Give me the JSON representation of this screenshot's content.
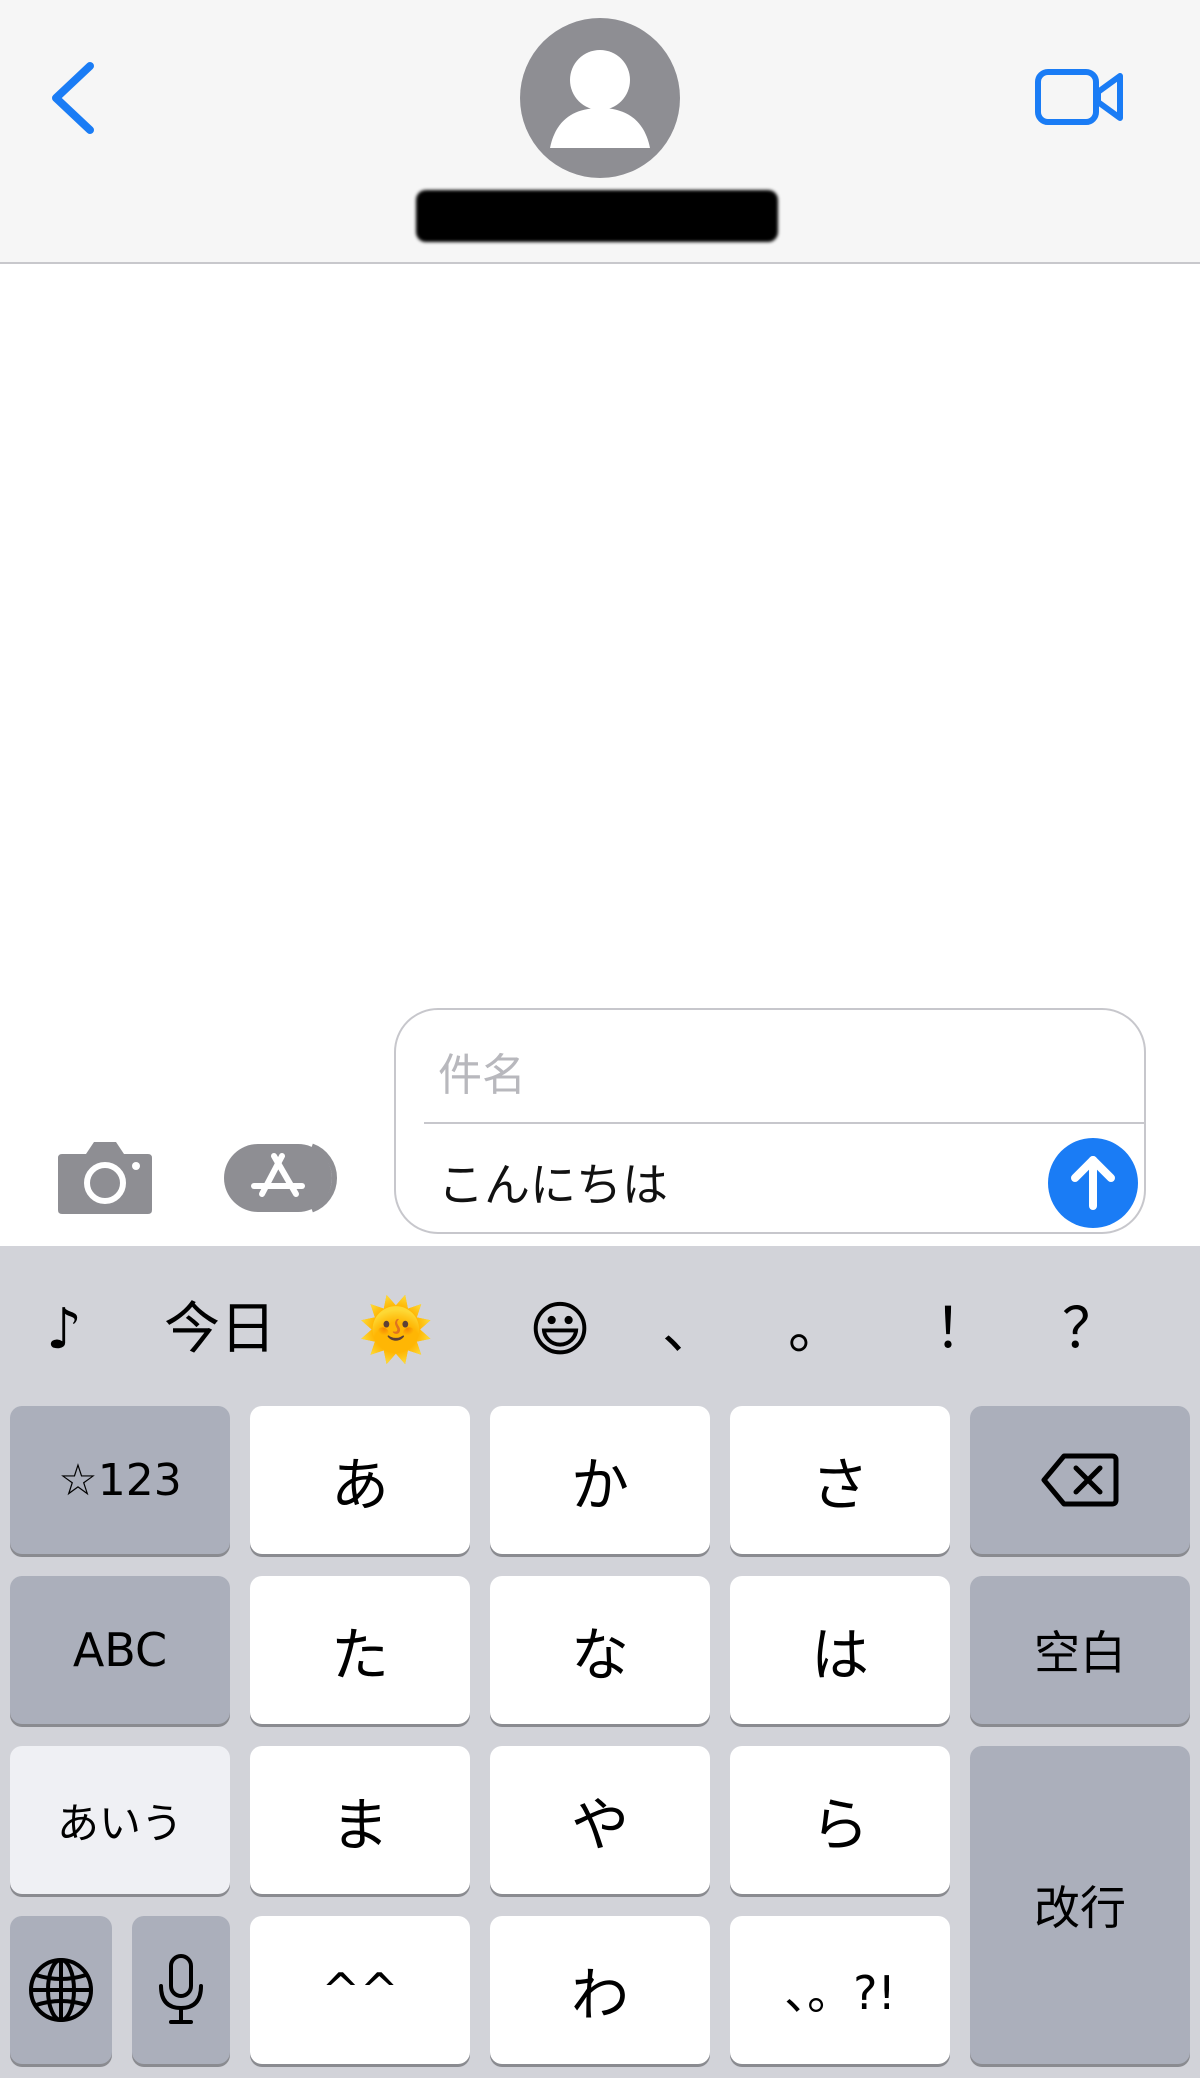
{
  "header": {
    "contact_name": "",
    "icons": {
      "back": "chevron-left-icon",
      "avatar": "person-icon",
      "video": "video-camera-icon"
    },
    "accent_color": "#1a7cf5"
  },
  "compose": {
    "subject_placeholder": "件名",
    "message_text": "こんにちは",
    "icons": {
      "camera": "camera-icon",
      "apps": "app-store-icon",
      "send": "arrow-up-icon"
    }
  },
  "candidates": [
    "♪",
    "今日",
    "🌞",
    "😃",
    "、",
    "。",
    "！",
    "？"
  ],
  "keyboard": {
    "symbols_key": "☆123",
    "abc_key": "ABC",
    "kana_key": "あいう",
    "row1": [
      "あ",
      "か",
      "さ"
    ],
    "row2": [
      "た",
      "な",
      "は"
    ],
    "row3": [
      "ま",
      "や",
      "ら"
    ],
    "row4": [
      "^^",
      "わ",
      "、。?!"
    ],
    "space_key": "空白",
    "return_key": "改行",
    "icons": {
      "delete": "delete-backspace-icon",
      "globe": "globe-icon",
      "mic": "microphone-icon"
    }
  }
}
